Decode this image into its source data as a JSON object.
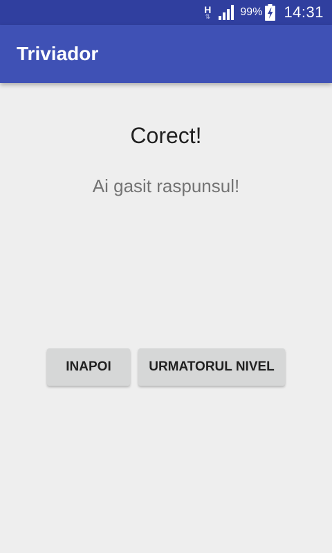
{
  "status_bar": {
    "network_type": "H",
    "network_arrows": "⇅",
    "battery_percent": "99%",
    "time": "14:31",
    "icons": [
      "network-type-icon",
      "signal-icon",
      "battery-charging-icon"
    ]
  },
  "app_bar": {
    "title": "Triviador",
    "color": "#3f51b5",
    "status_color": "#303f9f"
  },
  "main": {
    "headline": "Corect!",
    "message": "Ai gasit raspunsul!"
  },
  "actions": {
    "back_label": "INAPOI",
    "next_label": "URMATORUL NIVEL"
  }
}
